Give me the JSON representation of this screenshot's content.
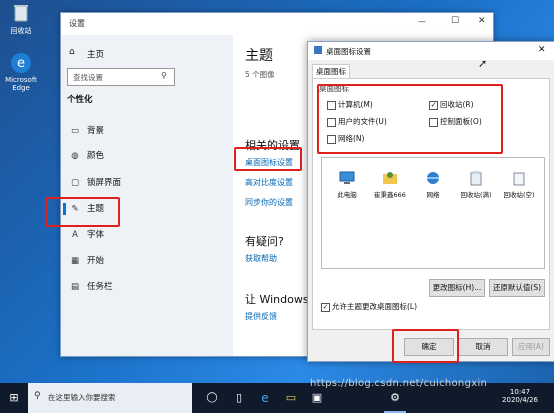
{
  "desktop": {
    "icons": [
      {
        "label": "回收站",
        "icon": "recycle-bin-icon"
      },
      {
        "label": "Microsoft Edge",
        "icon": "edge-icon"
      }
    ]
  },
  "settings": {
    "window_title": "设置",
    "controls": {
      "minimize": "—",
      "maximize": "☐",
      "close": "✕"
    },
    "back": "←",
    "home_label": "主页",
    "search_placeholder": "查找设置",
    "section_title": "个性化",
    "nav": [
      {
        "label": "背景",
        "icon": "image-icon"
      },
      {
        "label": "颜色",
        "icon": "palette-icon"
      },
      {
        "label": "锁屏界面",
        "icon": "lock-screen-icon"
      },
      {
        "label": "主题",
        "icon": "theme-icon"
      },
      {
        "label": "字体",
        "icon": "font-icon"
      },
      {
        "label": "开始",
        "icon": "start-icon"
      },
      {
        "label": "任务栏",
        "icon": "taskbar-icon"
      }
    ],
    "main": {
      "title": "主题",
      "subtitle": "5 个图像",
      "related_heading": "相关的设置",
      "related_links": [
        "桌面图标设置",
        "高对比度设置",
        "同步你的设置"
      ],
      "question_heading": "有疑问?",
      "help_link": "获取帮助",
      "improve_heading": "让 Windows 变",
      "feedback_link": "提供反馈"
    }
  },
  "dialog": {
    "title": "桌面图标设置",
    "close": "✕",
    "tab": "桌面图标",
    "group_label": "桌面图标",
    "checkboxes": [
      {
        "label": "计算机(M)",
        "checked": false
      },
      {
        "label": "回收站(R)",
        "checked": true
      },
      {
        "label": "用户的文件(U)",
        "checked": false
      },
      {
        "label": "控制面板(O)",
        "checked": false
      },
      {
        "label": "网络(N)",
        "checked": false
      }
    ],
    "icons": [
      {
        "label": "此电脑",
        "icon": "computer-icon"
      },
      {
        "label": "崔秉鑫666",
        "icon": "user-folder-icon"
      },
      {
        "label": "网络",
        "icon": "network-icon"
      },
      {
        "label": "回收站(满)",
        "icon": "recycle-bin-full-icon"
      },
      {
        "label": "回收站(空)",
        "icon": "recycle-bin-empty-icon"
      }
    ],
    "change_icon": "更改图标(H)...",
    "restore_default": "还原默认值(S)",
    "allow_themes": "允许主题更改桌面图标(L)",
    "ok": "确定",
    "cancel": "取消",
    "apply": "应用(A)"
  },
  "taskbar": {
    "search_placeholder": "在这里输入你要搜索",
    "time": "10:47",
    "date": "2020/4/26"
  },
  "watermark": "https://blog.csdn.net/cuichongxin"
}
